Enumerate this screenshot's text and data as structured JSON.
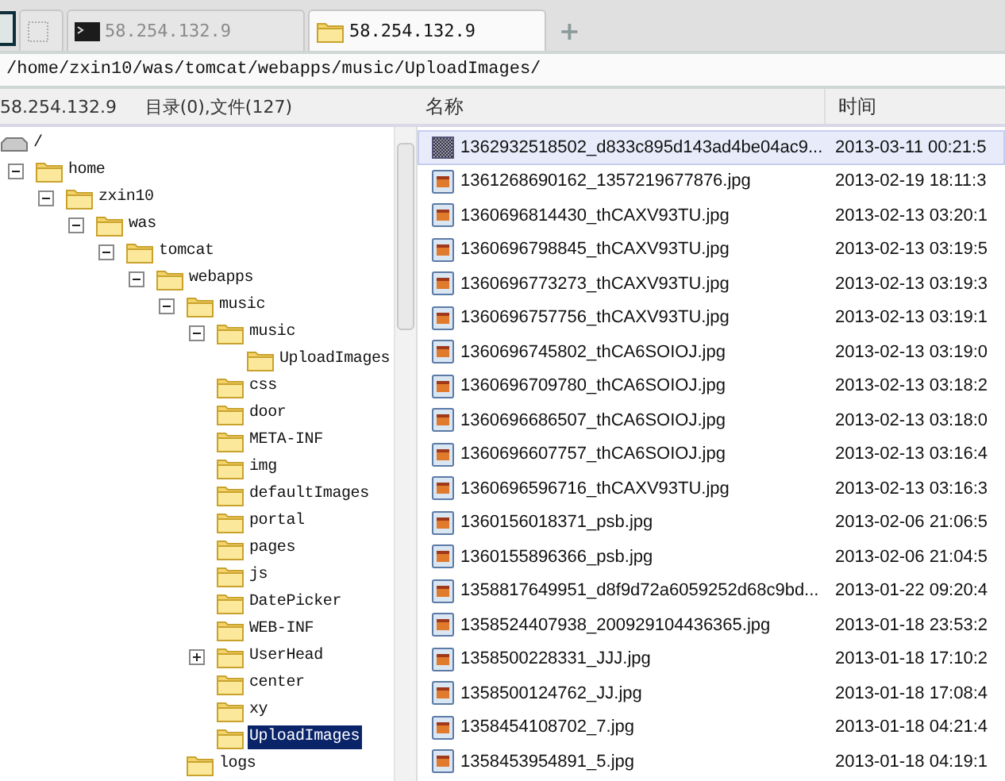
{
  "tabs": [
    {
      "kind": "blank",
      "selected": false
    },
    {
      "kind": "terminal",
      "label": "58.254.132.9",
      "selected": false
    },
    {
      "kind": "folder",
      "label": "58.254.132.9",
      "selected": true
    }
  ],
  "new_tab": "+",
  "path": "/home/zxin10/was/tomcat/webapps/music/UploadImages/",
  "left_header": {
    "host": "58.254.132.9",
    "summary": "目录(0),文件(127)"
  },
  "columns": [
    "名称",
    "时间"
  ],
  "tree": {
    "root_label": "/",
    "items": [
      {
        "label": "home",
        "expanded": true,
        "selected": false,
        "children": [
          {
            "label": "zxin10",
            "expanded": true,
            "selected": false,
            "children": [
              {
                "label": "was",
                "expanded": true,
                "selected": false,
                "children": [
                  {
                    "label": "tomcat",
                    "expanded": true,
                    "selected": false,
                    "children": [
                      {
                        "label": "webapps",
                        "expanded": true,
                        "selected": false,
                        "children": [
                          {
                            "label": "music",
                            "expanded": true,
                            "selected": false,
                            "children": [
                              {
                                "label": "music",
                                "expanded": true,
                                "selected": false,
                                "children": [
                                  {
                                    "label": "UploadImages",
                                    "selected": false
                                  }
                                ]
                              },
                              {
                                "label": "css",
                                "selected": false
                              },
                              {
                                "label": "door",
                                "selected": false
                              },
                              {
                                "label": "META-INF",
                                "selected": false
                              },
                              {
                                "label": "img",
                                "selected": false
                              },
                              {
                                "label": "defaultImages",
                                "selected": false
                              },
                              {
                                "label": "portal",
                                "selected": false
                              },
                              {
                                "label": "pages",
                                "selected": false
                              },
                              {
                                "label": "js",
                                "selected": false
                              },
                              {
                                "label": "DatePicker",
                                "selected": false
                              },
                              {
                                "label": "WEB-INF",
                                "selected": false
                              },
                              {
                                "label": "UserHead",
                                "expanded": false,
                                "selected": false
                              },
                              {
                                "label": "center",
                                "selected": false
                              },
                              {
                                "label": "xy",
                                "selected": false
                              },
                              {
                                "label": "UploadImages",
                                "selected": true
                              }
                            ]
                          },
                          {
                            "label": "logs",
                            "selected": false
                          }
                        ]
                      }
                    ]
                  }
                ]
              }
            ]
          }
        ]
      }
    ]
  },
  "files": [
    {
      "kind": "pattern",
      "name": "1362932518502_d833c895d143ad4be04ac9...",
      "time": "2013-03-11 00:21:5",
      "selected": true
    },
    {
      "kind": "jpg",
      "name": "1361268690162_1357219677876.jpg",
      "time": "2013-02-19 18:11:3",
      "selected": false
    },
    {
      "kind": "jpg",
      "name": "1360696814430_thCAXV93TU.jpg",
      "time": "2013-02-13 03:20:1",
      "selected": false
    },
    {
      "kind": "jpg",
      "name": "1360696798845_thCAXV93TU.jpg",
      "time": "2013-02-13 03:19:5",
      "selected": false
    },
    {
      "kind": "jpg",
      "name": "1360696773273_thCAXV93TU.jpg",
      "time": "2013-02-13 03:19:3",
      "selected": false
    },
    {
      "kind": "jpg",
      "name": "1360696757756_thCAXV93TU.jpg",
      "time": "2013-02-13 03:19:1",
      "selected": false
    },
    {
      "kind": "jpg",
      "name": "1360696745802_thCA6SOIOJ.jpg",
      "time": "2013-02-13 03:19:0",
      "selected": false
    },
    {
      "kind": "jpg",
      "name": "1360696709780_thCA6SOIOJ.jpg",
      "time": "2013-02-13 03:18:2",
      "selected": false
    },
    {
      "kind": "jpg",
      "name": "1360696686507_thCA6SOIOJ.jpg",
      "time": "2013-02-13 03:18:0",
      "selected": false
    },
    {
      "kind": "jpg",
      "name": "1360696607757_thCA6SOIOJ.jpg",
      "time": "2013-02-13 03:16:4",
      "selected": false
    },
    {
      "kind": "jpg",
      "name": "1360696596716_thCAXV93TU.jpg",
      "time": "2013-02-13 03:16:3",
      "selected": false
    },
    {
      "kind": "jpg",
      "name": "1360156018371_psb.jpg",
      "time": "2013-02-06 21:06:5",
      "selected": false
    },
    {
      "kind": "jpg",
      "name": "1360155896366_psb.jpg",
      "time": "2013-02-06 21:04:5",
      "selected": false
    },
    {
      "kind": "jpg",
      "name": "1358817649951_d8f9d72a6059252d68c9bd...",
      "time": "2013-01-22 09:20:4",
      "selected": false
    },
    {
      "kind": "jpg",
      "name": "1358524407938_200929104436365.jpg",
      "time": "2013-01-18 23:53:2",
      "selected": false
    },
    {
      "kind": "jpg",
      "name": "1358500228331_JJJ.jpg",
      "time": "2013-01-18 17:10:2",
      "selected": false
    },
    {
      "kind": "jpg",
      "name": "1358500124762_JJ.jpg",
      "time": "2013-01-18 17:08:4",
      "selected": false
    },
    {
      "kind": "jpg",
      "name": "1358454108702_7.jpg",
      "time": "2013-01-18 04:21:4",
      "selected": false
    },
    {
      "kind": "jpg",
      "name": "1358453954891_5.jpg",
      "time": "2013-01-18 04:19:1",
      "selected": false
    }
  ]
}
